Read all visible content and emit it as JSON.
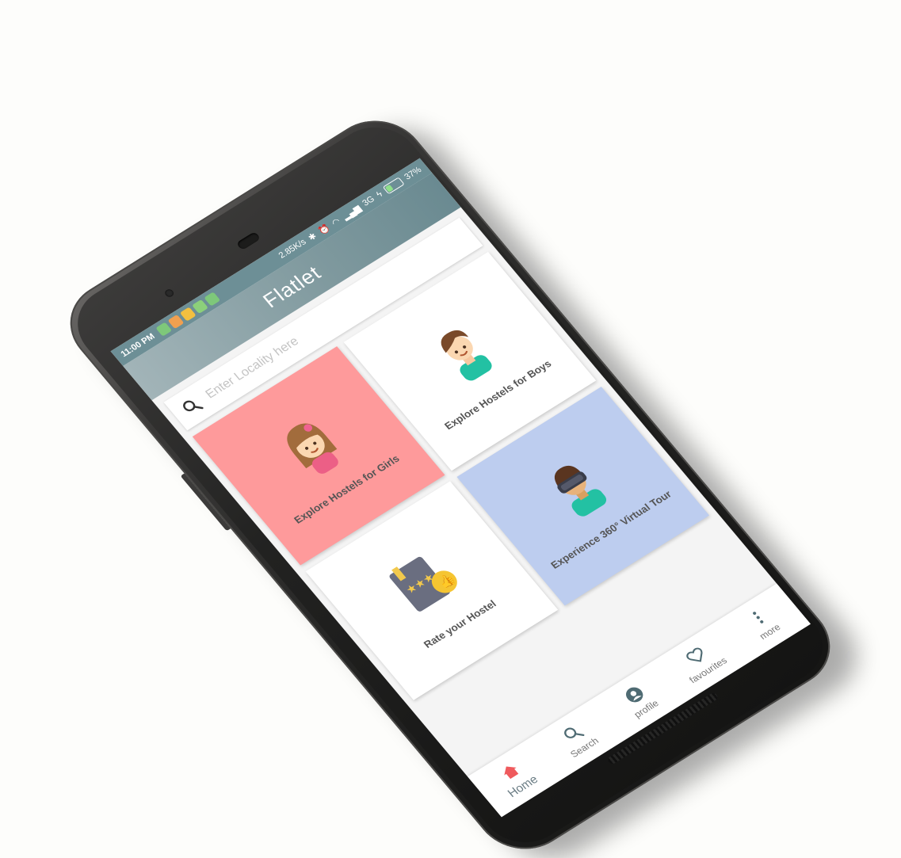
{
  "colors": {
    "accent": "#6d8f96",
    "girls_card": "#fe9a9b",
    "boys_card": "#ffffff",
    "rate_card": "#ffffff",
    "vr_card": "#bdcdef",
    "home_active": "#ef5a5d"
  },
  "status_bar": {
    "time": "11:00 PM",
    "network_speed": "2.85K/s",
    "network_type": "3G",
    "battery": "37%",
    "battery_level": 0.37
  },
  "app": {
    "title": "Flatlet"
  },
  "search": {
    "placeholder": "Enter Locality here",
    "icon": "search-icon"
  },
  "cards": [
    {
      "label": "Explore Hostels for Girls",
      "icon": "girl-avatar-icon"
    },
    {
      "label": "Explore Hostels for Boys",
      "icon": "boy-avatar-icon"
    },
    {
      "label": "Rate your Hostel",
      "icon": "rating-book-icon"
    },
    {
      "label": "Experience 360° Virtual Tour",
      "icon": "vr-headset-avatar-icon"
    }
  ],
  "bottom_nav": [
    {
      "label": "Home",
      "icon": "home-icon",
      "active": true
    },
    {
      "label": "Search",
      "icon": "search-icon",
      "active": false
    },
    {
      "label": "profile",
      "icon": "profile-icon",
      "active": false
    },
    {
      "label": "favourites",
      "icon": "heart-icon",
      "active": false
    },
    {
      "label": "more",
      "icon": "more-vertical-icon",
      "active": false
    }
  ]
}
